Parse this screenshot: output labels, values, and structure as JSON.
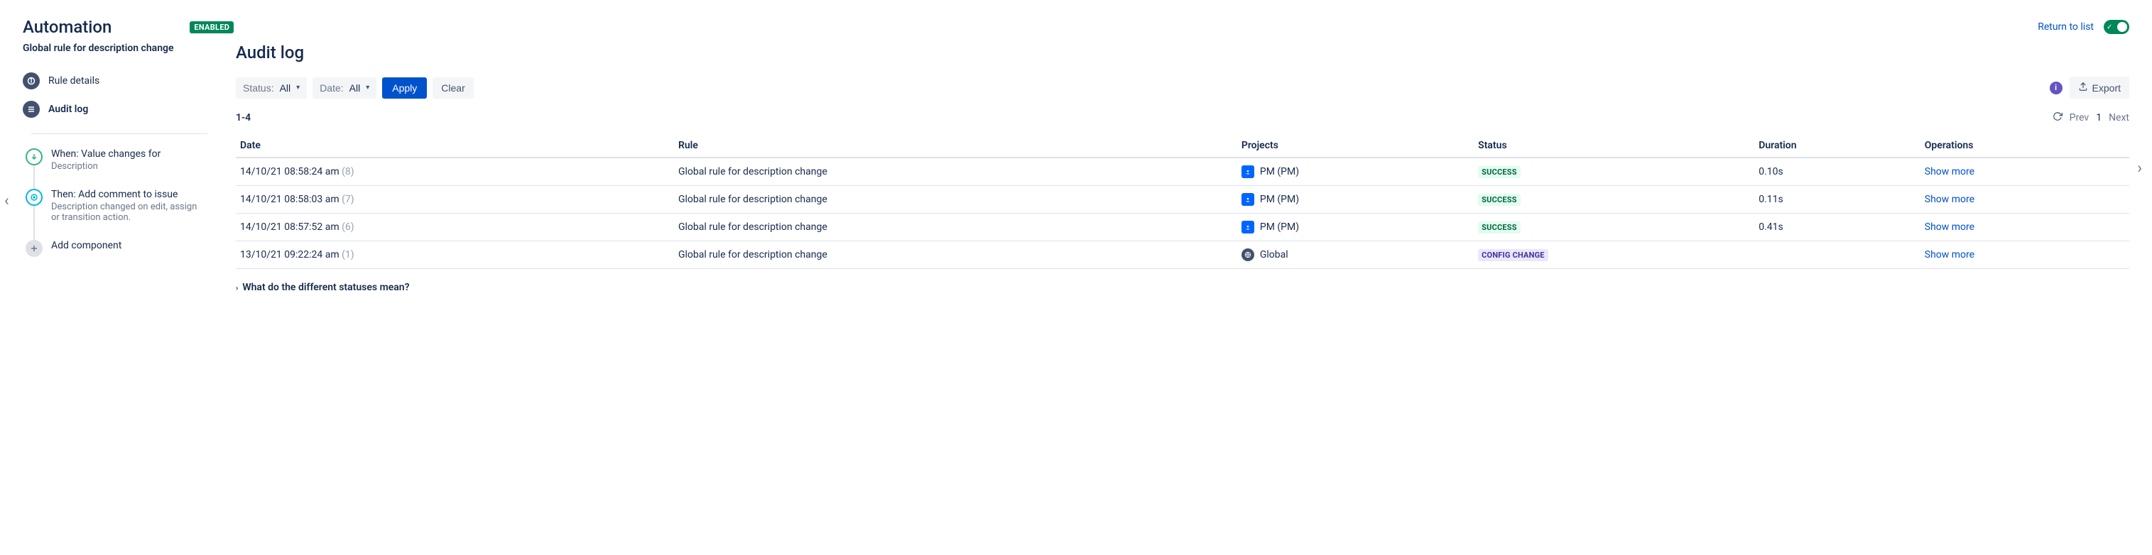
{
  "header": {
    "title": "Automation",
    "enabled_badge": "ENABLED",
    "return_link": "Return to list"
  },
  "rule": {
    "name": "Global rule for description change"
  },
  "sidebar": {
    "nav": [
      {
        "label": "Rule details",
        "active": false
      },
      {
        "label": "Audit log",
        "active": true
      }
    ],
    "steps": [
      {
        "title": "When: Value changes for",
        "sub": "Description"
      },
      {
        "title": "Then: Add comment to issue",
        "sub": "Description changed on edit, assign or transition action."
      }
    ],
    "add_component": "Add component"
  },
  "main": {
    "title": "Audit log",
    "filters": {
      "status_label": "Status:",
      "status_value": "All",
      "date_label": "Date:",
      "date_value": "All",
      "apply": "Apply",
      "clear": "Clear",
      "export": "Export"
    },
    "pagination": {
      "range": "1-4",
      "prev": "Prev",
      "page": "1",
      "next": "Next"
    },
    "columns": {
      "date": "Date",
      "rule": "Rule",
      "projects": "Projects",
      "status": "Status",
      "duration": "Duration",
      "operations": "Operations"
    },
    "rows": [
      {
        "date": "14/10/21 08:58:24 am",
        "count": "(8)",
        "rule": "Global rule for description change",
        "project": "PM (PM)",
        "project_kind": "pm",
        "status": "SUCCESS",
        "status_kind": "success",
        "duration": "0.10s",
        "op": "Show more"
      },
      {
        "date": "14/10/21 08:58:03 am",
        "count": "(7)",
        "rule": "Global rule for description change",
        "project": "PM (PM)",
        "project_kind": "pm",
        "status": "SUCCESS",
        "status_kind": "success",
        "duration": "0.11s",
        "op": "Show more"
      },
      {
        "date": "14/10/21 08:57:52 am",
        "count": "(6)",
        "rule": "Global rule for description change",
        "project": "PM (PM)",
        "project_kind": "pm",
        "status": "SUCCESS",
        "status_kind": "success",
        "duration": "0.41s",
        "op": "Show more"
      },
      {
        "date": "13/10/21 09:22:24 am",
        "count": "(1)",
        "rule": "Global rule for description change",
        "project": "Global",
        "project_kind": "global",
        "status": "CONFIG CHANGE",
        "status_kind": "config",
        "duration": "",
        "op": "Show more"
      }
    ],
    "help_expand": "What do the different statuses mean?"
  }
}
